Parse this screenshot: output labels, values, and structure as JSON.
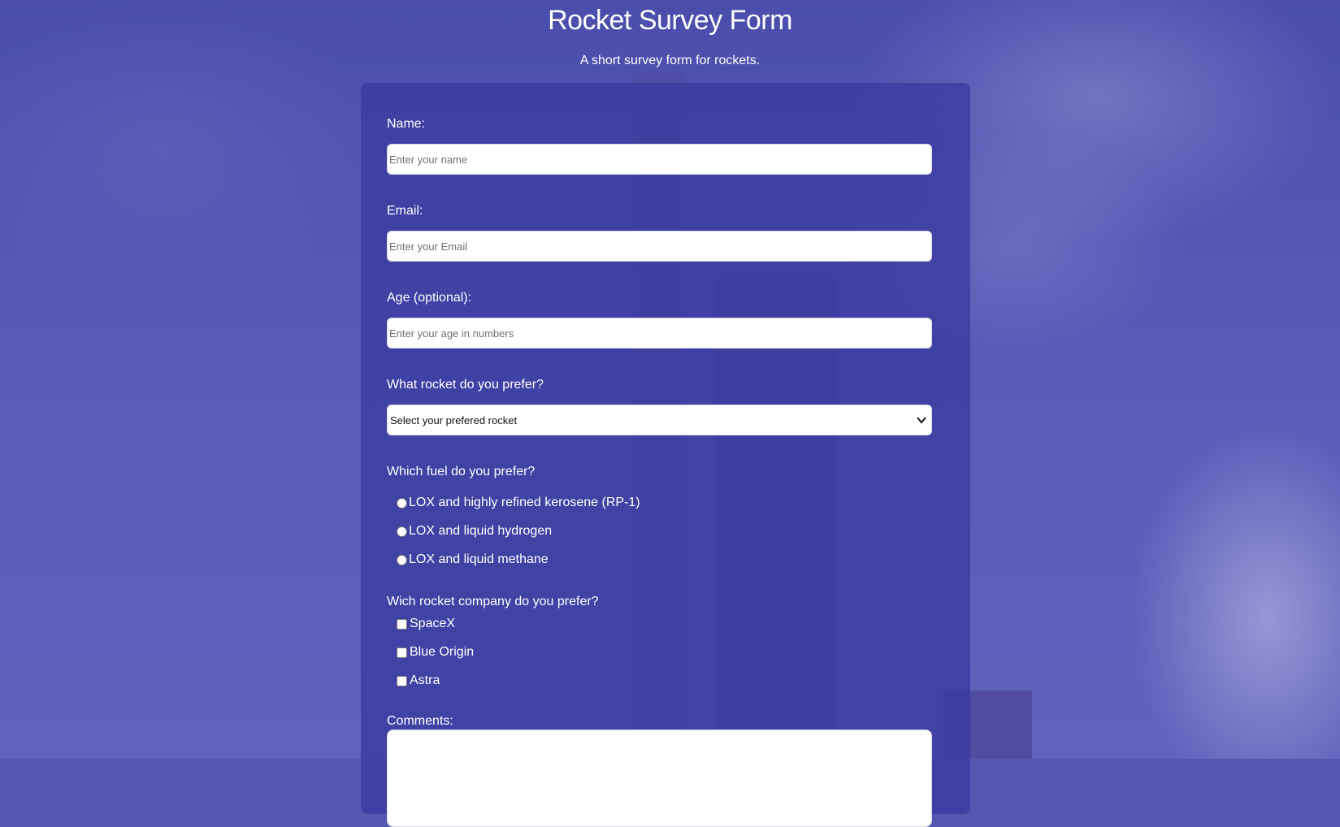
{
  "page": {
    "title": "Rocket Survey Form",
    "description": "A short survey form for rockets."
  },
  "form": {
    "name": {
      "label": "Name:",
      "placeholder": "Enter your name",
      "value": ""
    },
    "email": {
      "label": "Email:",
      "placeholder": "Enter your Email",
      "value": ""
    },
    "age": {
      "label": "Age (optional):",
      "placeholder": "Enter your age in numbers",
      "value": ""
    },
    "rocket": {
      "label": "What rocket do you prefer?",
      "selected": "Select your prefered rocket"
    },
    "fuel": {
      "label": "Which fuel do you prefer?",
      "options": [
        "LOX and highly refined kerosene (RP-1)",
        "LOX and liquid hydrogen",
        "LOX and liquid methane"
      ]
    },
    "company": {
      "label": "Wich rocket company do you prefer?",
      "options": [
        "SpaceX",
        "Blue Origin",
        "Astra"
      ]
    },
    "comments": {
      "label": "Comments:"
    }
  },
  "colors": {
    "background": "#5457b0",
    "card": "#3a3ca0",
    "text": "#ffffff"
  }
}
